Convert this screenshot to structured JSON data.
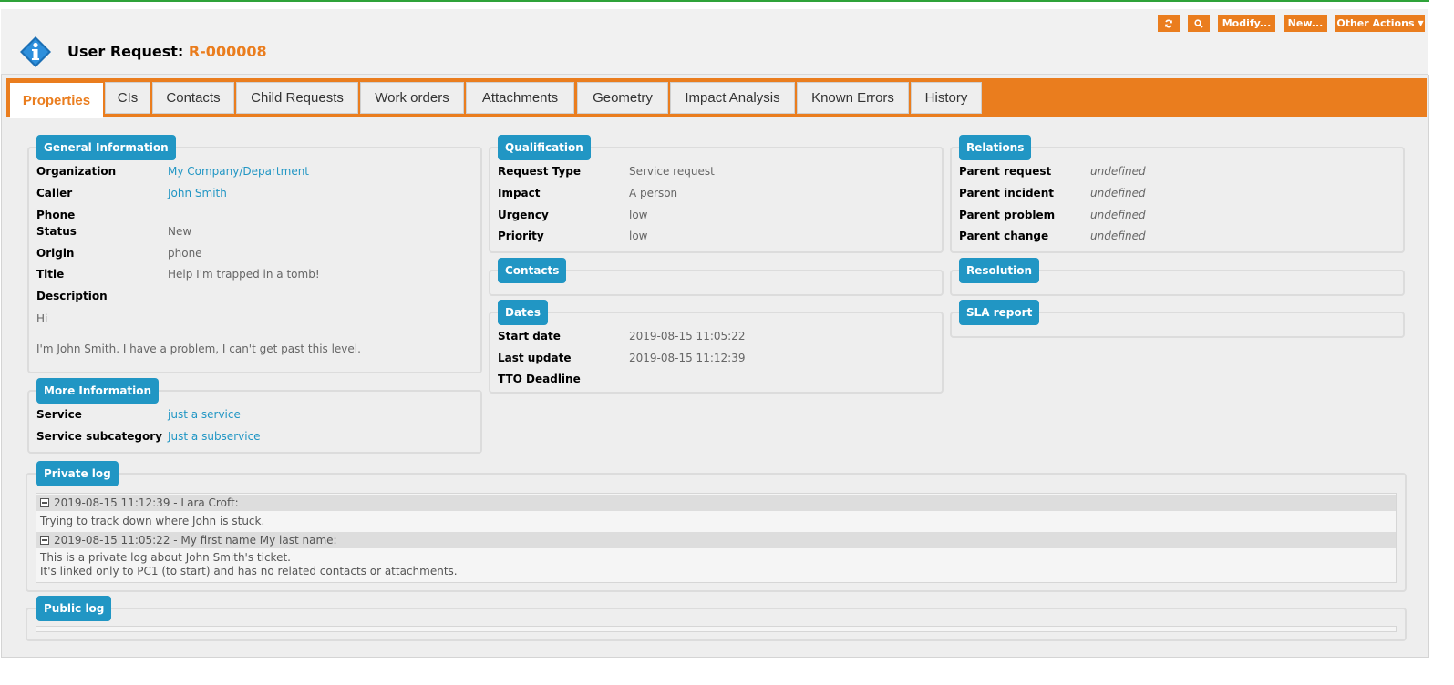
{
  "header": {
    "object_type": "User Request:",
    "ref": "R-000008",
    "actions": {
      "refresh_icon": "refresh-icon",
      "search_icon": "search-icon",
      "modify": "Modify...",
      "new": "New...",
      "other_actions": "Other Actions"
    }
  },
  "tabs": [
    "Properties",
    "CIs",
    "Contacts",
    "Child Requests",
    "Work orders",
    "Attachments",
    "Geometry",
    "Impact Analysis",
    "Known Errors",
    "History"
  ],
  "general": {
    "legend": "General Information",
    "organization_label": "Organization",
    "organization_value": "My Company/Department",
    "caller_label": "Caller",
    "caller_value": "John Smith",
    "phone_label": "Phone",
    "status_label": "Status",
    "status_value": "New",
    "origin_label": "Origin",
    "origin_value": "phone",
    "title_label": "Title",
    "title_value": "Help I'm trapped in a tomb!",
    "description_label": "Description",
    "description_line1": "Hi",
    "description_line2": "I'm John Smith. I have a problem, I can't get past this level."
  },
  "more": {
    "legend": "More Information",
    "service_label": "Service",
    "service_value": "just a service",
    "subcategory_label": "Service subcategory",
    "subcategory_value": "Just a subservice"
  },
  "qualification": {
    "legend": "Qualification",
    "type_label": "Request Type",
    "type_value": "Service request",
    "impact_label": "Impact",
    "impact_value": "A person",
    "urgency_label": "Urgency",
    "urgency_value": "low",
    "priority_label": "Priority",
    "priority_value": "low"
  },
  "contacts": {
    "legend": "Contacts"
  },
  "dates": {
    "legend": "Dates",
    "start_label": "Start date",
    "start_value": "2019-08-15 11:05:22",
    "update_label": "Last update",
    "update_value": "2019-08-15 11:12:39",
    "tto_label": "TTO Deadline"
  },
  "relations": {
    "legend": "Relations",
    "parent_request_label": "Parent request",
    "parent_request_value": "undefined",
    "parent_incident_label": "Parent incident",
    "parent_incident_value": "undefined",
    "parent_problem_label": "Parent problem",
    "parent_problem_value": "undefined",
    "parent_change_label": "Parent change",
    "parent_change_value": "undefined"
  },
  "resolution": {
    "legend": "Resolution"
  },
  "sla": {
    "legend": "SLA report"
  },
  "private_log": {
    "legend": "Private log",
    "entries": [
      {
        "header": "2019-08-15 11:12:39 - Lara Croft:",
        "lines": [
          "Trying to track down where John is stuck."
        ]
      },
      {
        "header": "2019-08-15 11:05:22 - My first name My last name:",
        "lines": [
          "This is a private log about John Smith's ticket.",
          "It's linked only to PC1 (to start) and has no related contacts or attachments."
        ]
      }
    ]
  },
  "public_log": {
    "legend": "Public log"
  },
  "colors": {
    "accent": "#ea7d1e",
    "legend_blue": "#2196c4",
    "link": "#2196c4"
  }
}
